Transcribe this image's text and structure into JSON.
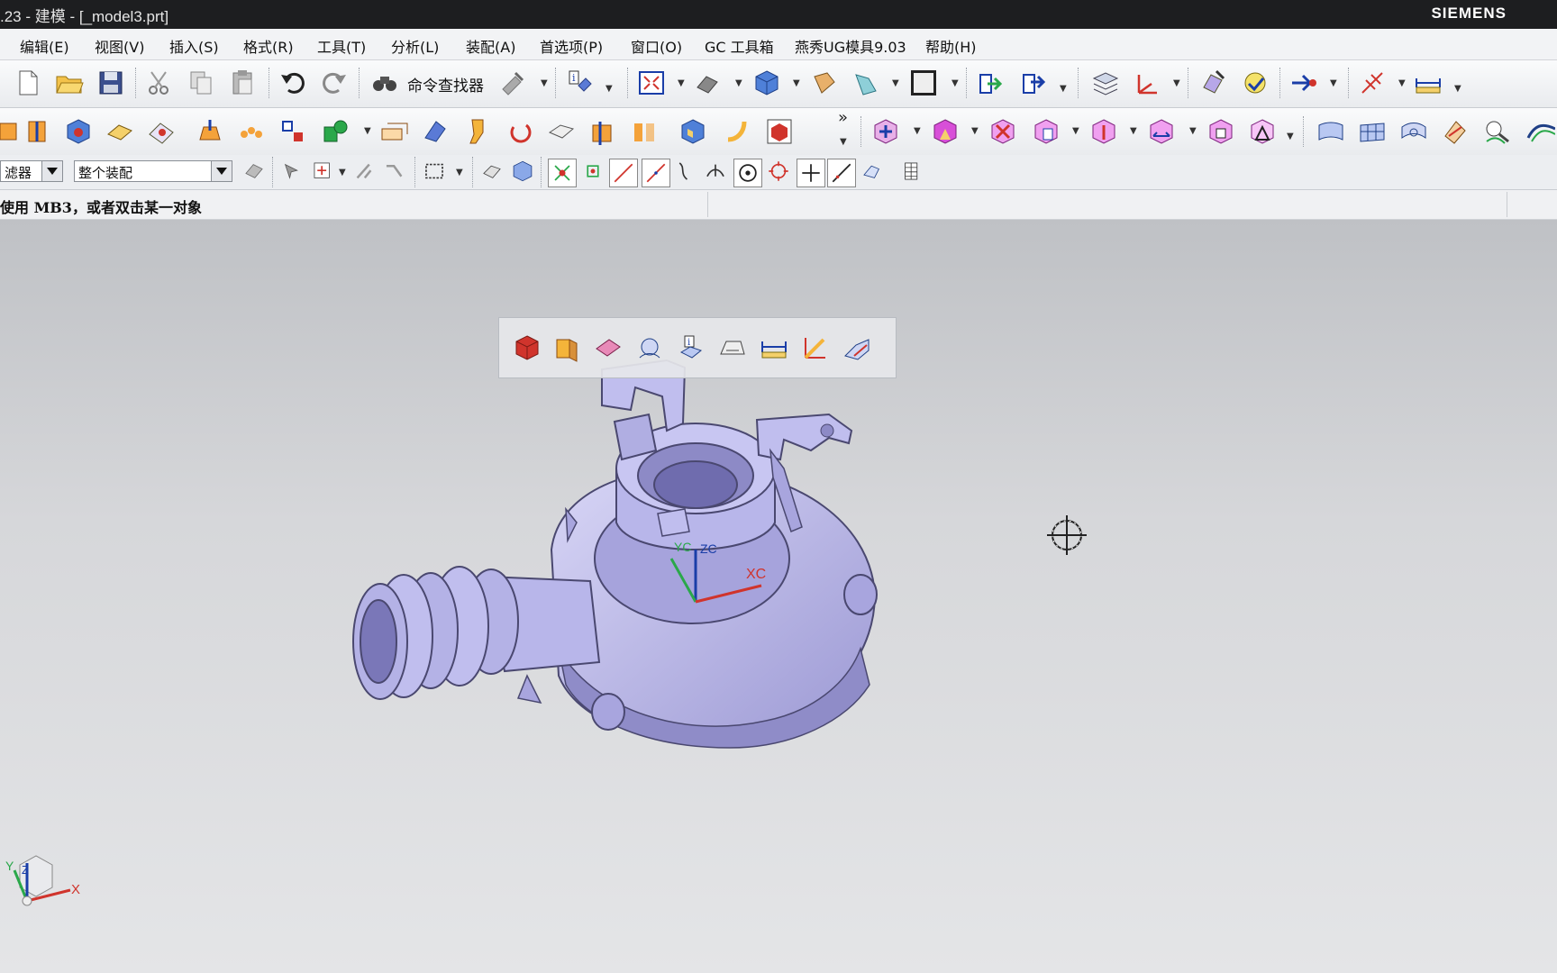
{
  "window": {
    "title": ".23 - 建模 - [_model3.prt]",
    "brand": "SIEMENS"
  },
  "menu": [
    {
      "id": "edit",
      "label": "编辑(E)"
    },
    {
      "id": "view",
      "label": "视图(V)"
    },
    {
      "id": "insert",
      "label": "插入(S)"
    },
    {
      "id": "format",
      "label": "格式(R)"
    },
    {
      "id": "tools",
      "label": "工具(T)"
    },
    {
      "id": "analysis",
      "label": "分析(L)"
    },
    {
      "id": "assembly",
      "label": "装配(A)"
    },
    {
      "id": "preferences",
      "label": "首选项(P)"
    },
    {
      "id": "window",
      "label": "窗口(O)"
    },
    {
      "id": "gc",
      "label": "GC 工具箱"
    },
    {
      "id": "yanxiu",
      "label": "燕秀UG模具9.03"
    },
    {
      "id": "help",
      "label": "帮助(H)"
    }
  ],
  "toolbar": {
    "command_finder": "命令查找器",
    "more": "»"
  },
  "selection_bar": {
    "type_filter": "滤器",
    "scope": "整个装配"
  },
  "cue_line": {
    "message": "使用 MB3，或者双击某一对象"
  },
  "viewport": {
    "wcs_x_label": "XC",
    "wcs_y_label": "YC",
    "wcs_z_label": "ZC",
    "triad_x": "X",
    "triad_y": "Y",
    "triad_z": "Z"
  },
  "colors": {
    "part_fill": "#b4b2e6",
    "part_edge": "#4a4870",
    "titlebar": "#1d1e20",
    "accent_red": "#d0342c"
  }
}
